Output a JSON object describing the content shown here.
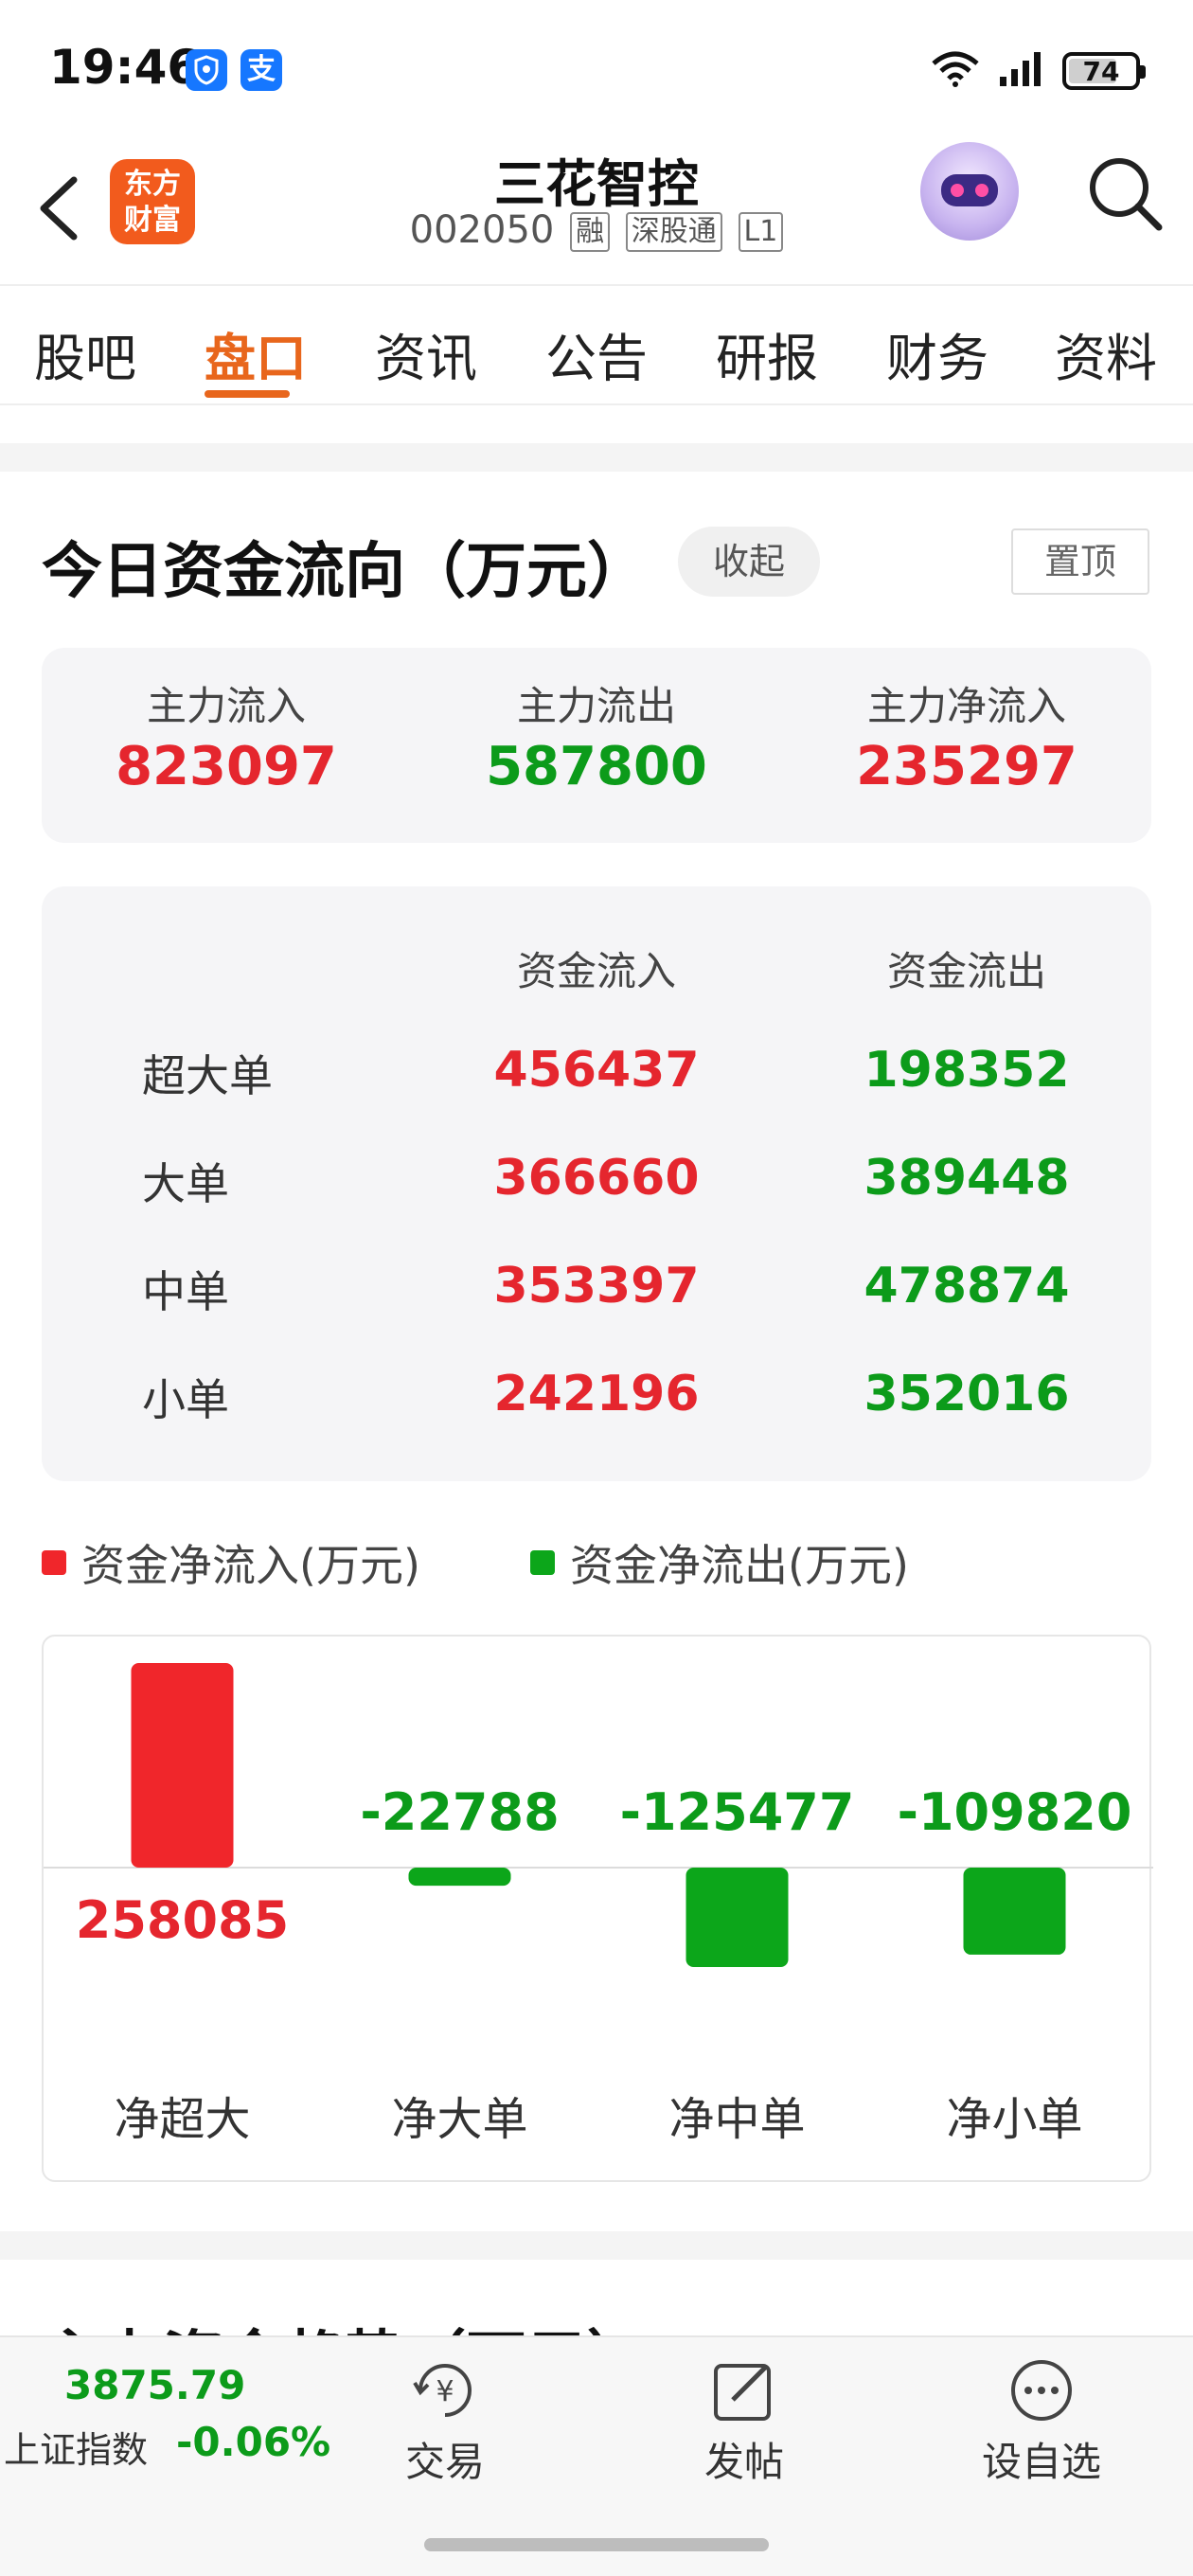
{
  "status_bar": {
    "time": "19:46",
    "app_badge_1_icon": "shield-app-icon",
    "app_badge_2_label": "支",
    "battery": "74",
    "battery_level": 0.74
  },
  "header": {
    "logo_line1": "东方",
    "logo_line2": "财富",
    "stock_name": "三花智控",
    "stock_code": "002050",
    "tags": [
      "融",
      "深股通",
      "L1"
    ]
  },
  "tabs": [
    {
      "label": "股吧"
    },
    {
      "label": "盘口",
      "active": true
    },
    {
      "label": "资讯"
    },
    {
      "label": "公告"
    },
    {
      "label": "研报"
    },
    {
      "label": "财务"
    },
    {
      "label": "资料"
    }
  ],
  "section": {
    "title": "今日资金流向（万元）",
    "collapse_label": "收起",
    "pin_label": "置顶"
  },
  "main_flow": [
    {
      "label": "主力流入",
      "value": "823097",
      "color": "#e5262e"
    },
    {
      "label": "主力流出",
      "value": "587800",
      "color": "#0c9b1a"
    },
    {
      "label": "主力净流入",
      "value": "235297",
      "color": "#e5262e"
    }
  ],
  "order_table": {
    "headers": [
      "资金流入",
      "资金流出"
    ],
    "rows": [
      {
        "label": "超大单",
        "inflow": "456437",
        "outflow": "198352"
      },
      {
        "label": "大单",
        "inflow": "366660",
        "outflow": "389448"
      },
      {
        "label": "中单",
        "inflow": "353397",
        "outflow": "478874"
      },
      {
        "label": "小单",
        "inflow": "242196",
        "outflow": "352016"
      }
    ]
  },
  "legend": {
    "inflow_label": "资金净流入(万元)",
    "outflow_label": "资金净流出(万元)",
    "inflow_color": "#f0262b",
    "outflow_color": "#0ca61a"
  },
  "chart_data": {
    "type": "bar",
    "categories": [
      "净超大",
      "净大单",
      "净中单",
      "净小单"
    ],
    "values": [
      258085,
      -22788,
      -125477,
      -109820
    ],
    "value_labels": [
      "258085",
      "-22788",
      "-125477",
      "-109820"
    ],
    "positive_color": "#f0262b",
    "negative_color": "#0ca61a"
  },
  "next_section_title": "主力资金趋势（万元）",
  "bottom_bar": {
    "index_value": "3875.79",
    "index_name": "上证指数",
    "index_change": "-0.06%",
    "nav": [
      {
        "label": "交易",
        "icon": "trade-icon"
      },
      {
        "label": "发帖",
        "icon": "post-icon"
      },
      {
        "label": "设自选",
        "icon": "add-watchlist-icon"
      }
    ]
  }
}
